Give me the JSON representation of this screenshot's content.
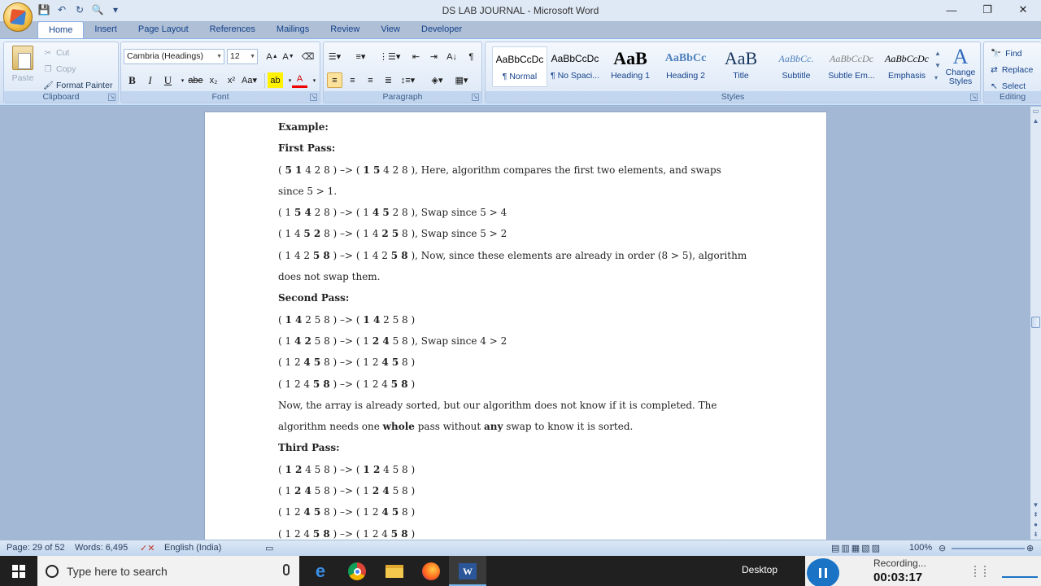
{
  "window": {
    "title": "DS LAB JOURNAL - Microsoft Word",
    "controls": {
      "minimize": "—",
      "restore": "❐",
      "close": "✕"
    }
  },
  "qat": [
    "save-icon",
    "undo-icon",
    "redo-icon",
    "print-preview-icon",
    "customize-icon"
  ],
  "tabs": [
    {
      "label": "Home",
      "active": true
    },
    {
      "label": "Insert"
    },
    {
      "label": "Page Layout"
    },
    {
      "label": "References"
    },
    {
      "label": "Mailings"
    },
    {
      "label": "Review"
    },
    {
      "label": "View"
    },
    {
      "label": "Developer"
    }
  ],
  "clipboard": {
    "paste": "Paste",
    "cut": "Cut",
    "copy": "Copy",
    "format_painter": "Format Painter",
    "label": "Clipboard"
  },
  "font": {
    "family": "Cambria (Headings)",
    "size": "12",
    "label": "Font"
  },
  "paragraph": {
    "label": "Paragraph"
  },
  "styles": {
    "label": "Styles",
    "items": [
      {
        "preview": "AaBbCcDc",
        "name": "¶ Normal",
        "selected": true
      },
      {
        "preview": "AaBbCcDc",
        "name": "¶ No Spaci..."
      },
      {
        "preview": "AaB",
        "name": "Heading 1"
      },
      {
        "preview": "AaBbCc",
        "name": "Heading 2"
      },
      {
        "preview": "AaB",
        "name": "Title"
      },
      {
        "preview": "AaBbCc.",
        "name": "Subtitle"
      },
      {
        "preview": "AaBbCcDc",
        "name": "Subtle Em..."
      },
      {
        "preview": "AaBbCcDc",
        "name": "Emphasis"
      }
    ],
    "change_styles": "Change Styles"
  },
  "editing": {
    "label": "Editing",
    "find": "Find",
    "replace": "Replace",
    "select": "Select"
  },
  "document": {
    "lines": [
      {
        "html": "<b>Example:</b>"
      },
      {
        "html": "<b>First Pass:</b>"
      },
      {
        "html": "( <b>5 1</b> 4 2 8 ) –&gt; ( <b>1 5</b> 4 2 8 ), Here, algorithm compares the first two elements, and swaps"
      },
      {
        "html": "since 5 &gt; 1."
      },
      {
        "html": "( 1 <b>5 4</b> 2 8 ) –&gt;  ( 1 <b>4 5</b> 2 8 ), Swap since 5 &gt; 4"
      },
      {
        "html": "( 1 4 <b>5 2</b> 8 ) –&gt;  ( 1 4 <b>2 5</b> 8 ), Swap since 5 &gt; 2"
      },
      {
        "html": "( 1 4 2 <b>5 8</b> ) –&gt; ( 1 4 2 <b>5 8</b> ), Now, since these elements are already in order (8 &gt; 5), algorithm"
      },
      {
        "html": "does not swap them."
      },
      {
        "html": "<b>Second Pass:</b>"
      },
      {
        "html": "( <b>1 4</b> 2 5 8 ) –&gt; ( <b>1 4</b> 2 5 8 )"
      },
      {
        "html": "( 1 <b>4 2</b> 5 8 ) –&gt; ( 1 <b>2 4</b> 5 8 ), Swap since 4 &gt; 2"
      },
      {
        "html": "( 1 2 <b>4 5</b> 8 ) –&gt; ( 1 2 <b>4 5</b> 8 )"
      },
      {
        "html": "( 1 2 4 <b>5 8</b> ) –&gt;  ( 1 2 4 <b>5 8</b> )"
      },
      {
        "html": "Now, the array is already sorted, but our algorithm does not know if it is completed. The"
      },
      {
        "html": "algorithm needs one <b>whole</b> pass without <b>any</b> swap to know it is sorted."
      },
      {
        "html": "<b>Third Pass:</b>"
      },
      {
        "html": "( <b>1 2</b> 4 5 8 ) –&gt; ( <b>1 2</b> 4 5 8 )"
      },
      {
        "html": "( 1 <b>2 4</b> 5 8 ) –&gt; ( 1 <b>2 4</b> 5 8 )"
      },
      {
        "html": "( 1 2 <b>4 5</b> 8 ) –&gt; ( 1 2 <b>4 5</b> 8 )"
      },
      {
        "html": "( 1 2 4 <b>5 8</b> ) –&gt; ( 1 2 4 <b>5 8</b> )"
      }
    ]
  },
  "status": {
    "page": "Page: 29 of 52",
    "words": "Words: 6,495",
    "language": "English (India)",
    "zoom": "100%"
  },
  "taskbar": {
    "search_placeholder": "Type here to search",
    "desktop": "Desktop",
    "recording_label": "Recording...",
    "recording_time": "00:03:17"
  }
}
